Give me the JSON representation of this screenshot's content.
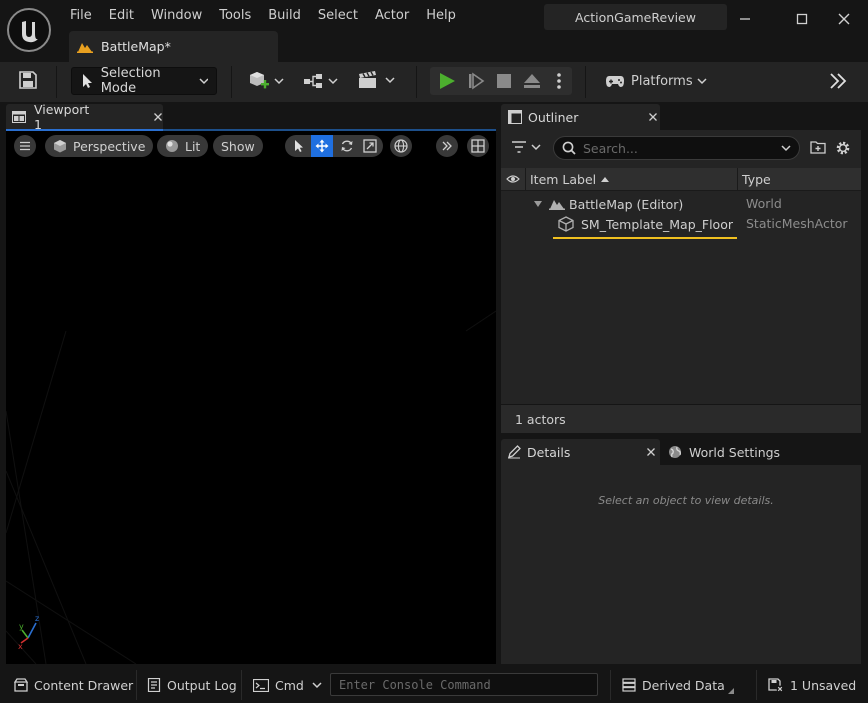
{
  "menu": [
    "File",
    "Edit",
    "Window",
    "Tools",
    "Build",
    "Select",
    "Actor",
    "Help"
  ],
  "project_name": "ActionGameReview",
  "doc_tab": {
    "label": "BattleMap*"
  },
  "toolbar": {
    "selection_mode": "Selection Mode",
    "platforms": "Platforms"
  },
  "viewport": {
    "tab_label": "Viewport 1",
    "perspective": "Perspective",
    "lit": "Lit",
    "show": "Show"
  },
  "outliner": {
    "tab_label": "Outliner",
    "search_placeholder": "Search...",
    "columns": {
      "label": "Item Label",
      "type": "Type"
    },
    "rows": [
      {
        "label": "BattleMap (Editor)",
        "type": "World"
      },
      {
        "label": "SM_Template_Map_Floor",
        "type": "StaticMeshActor"
      }
    ],
    "footer": "1 actors"
  },
  "details": {
    "tab_label": "Details",
    "world_settings_label": "World Settings",
    "empty_message": "Select an object to view details."
  },
  "statusbar": {
    "content_drawer": "Content Drawer",
    "output_log": "Output Log",
    "cmd": "Cmd",
    "console_placeholder": "Enter Console Command",
    "derived_data": "Derived Data",
    "unsaved": "1 Unsaved"
  },
  "colors": {
    "accent_blue": "#2a6fd0",
    "play_green": "#4caf2e",
    "highlight_yellow": "#f0c020",
    "map_icon_orange": "#e8a020"
  }
}
